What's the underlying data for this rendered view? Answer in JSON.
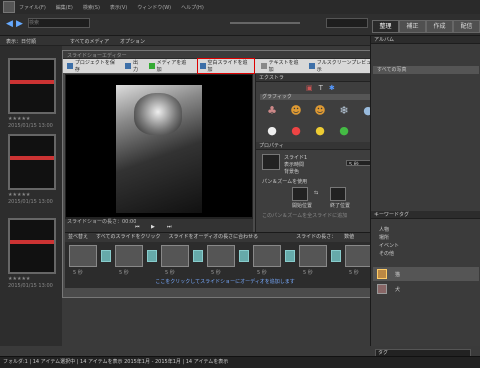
{
  "menu": {
    "items": [
      "ファイル(F)",
      "編集(E)",
      "検索(S)",
      "表示(V)",
      "ウィンドウ(W)",
      "ヘルプ(H)"
    ]
  },
  "search": {
    "placeholder": "検索"
  },
  "tabs": [
    {
      "label": "整理"
    },
    {
      "label": "補正"
    },
    {
      "label": "作成"
    },
    {
      "label": "配信"
    }
  ],
  "subbar": {
    "left": "表示：日付順",
    "center": "すべてのメディア",
    "right": "オプション"
  },
  "dialog": {
    "title": "スライドショーエディター",
    "toolbar": [
      "プロジェクトを保存",
      "出力",
      "メディアを追加",
      "空白スライドを追加",
      "テキストを追加",
      "フルスクリーンプレビュー表示"
    ],
    "highlight_index": 3,
    "panel": {
      "extras": "エクストラ",
      "graphics": "グラフィック",
      "properties": "プロパティ",
      "slide": "スライド1",
      "duration_label": "表示時間",
      "duration_value": "5 秒",
      "bgcolor_label": "背景色",
      "panzoom": "パン＆ズームを使用",
      "start": "開始位置",
      "end": "終了位置",
      "apply_all": "このパン＆ズームを全スライドに追加"
    },
    "ctrl_label": "スライドショーの長さ：00:00",
    "film_header": [
      "並べ替え",
      "すべてのスライドをクリック",
      "スライドをオーディオの長さに合わせる",
      "スライドの長さ：",
      "数値"
    ],
    "film_times": [
      "5 秒",
      "5 秒",
      "5 秒",
      "5 秒",
      "5 秒",
      "5 秒",
      "5 秒"
    ],
    "audio": "ここをクリックしてスライドショーにオーディオを追加します"
  },
  "right_panel": {
    "album": "アルバム",
    "album_item": "すべての写真",
    "keywords": "キーワードタグ",
    "tag_items": [
      "人物",
      "場所",
      "イベント",
      "その他"
    ],
    "cat_tag": "猫",
    "cat_tag2": "犬",
    "tag_search": "タグ"
  },
  "thumbs": {
    "caption": "2015/01/15 13:00",
    "stars": "★★★★★"
  },
  "status": "フォルダ:1 | 14 アイテム選択中 | 14 アイテムを表示 2015年1月 - 2015年1月 | 14 アイテムを表示"
}
